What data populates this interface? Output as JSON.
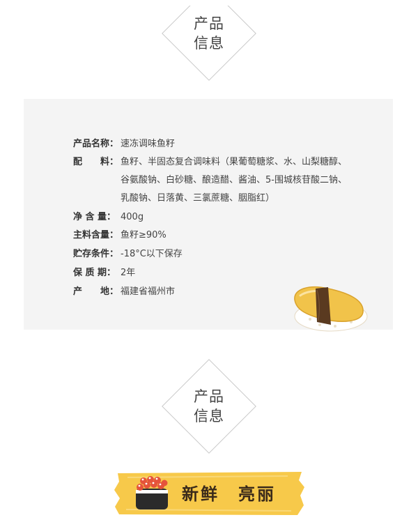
{
  "section1": {
    "title_line1": "产品",
    "title_line2": "信息"
  },
  "section2": {
    "title_line1": "产品",
    "title_line2": "信息"
  },
  "info": {
    "name": {
      "label": "产品名称：",
      "value": "速冻调味鱼籽"
    },
    "ingredients": {
      "label": "配　　料：",
      "line1": "鱼籽、半固态复合调味料（果葡萄糖浆、水、山梨糖醇、",
      "line2": "谷氨酸钠、白砂糖、酿造醋、酱油、5-围城核苷酸二钠、",
      "line3": "乳酸钠、日落黄、三氯蔗糖、胭脂红）"
    },
    "net": {
      "label": "净 含 量：",
      "value": "400g"
    },
    "main": {
      "label": "主料含量：",
      "value": "鱼籽≥90%"
    },
    "storage": {
      "label": "贮存条件：",
      "value": "-18°C以下保存"
    },
    "shelf": {
      "label": "保 质 期：",
      "value": "2年"
    },
    "origin": {
      "label": "产　　地：",
      "value": "福建省福州市"
    }
  },
  "banner": {
    "text": "新鲜　亮丽"
  },
  "colors": {
    "banner_yellow": "#f7c94a",
    "panel_bg": "#f4f4f4",
    "egg_yellow": "#f1c34a",
    "nori": "#5a3a20"
  }
}
